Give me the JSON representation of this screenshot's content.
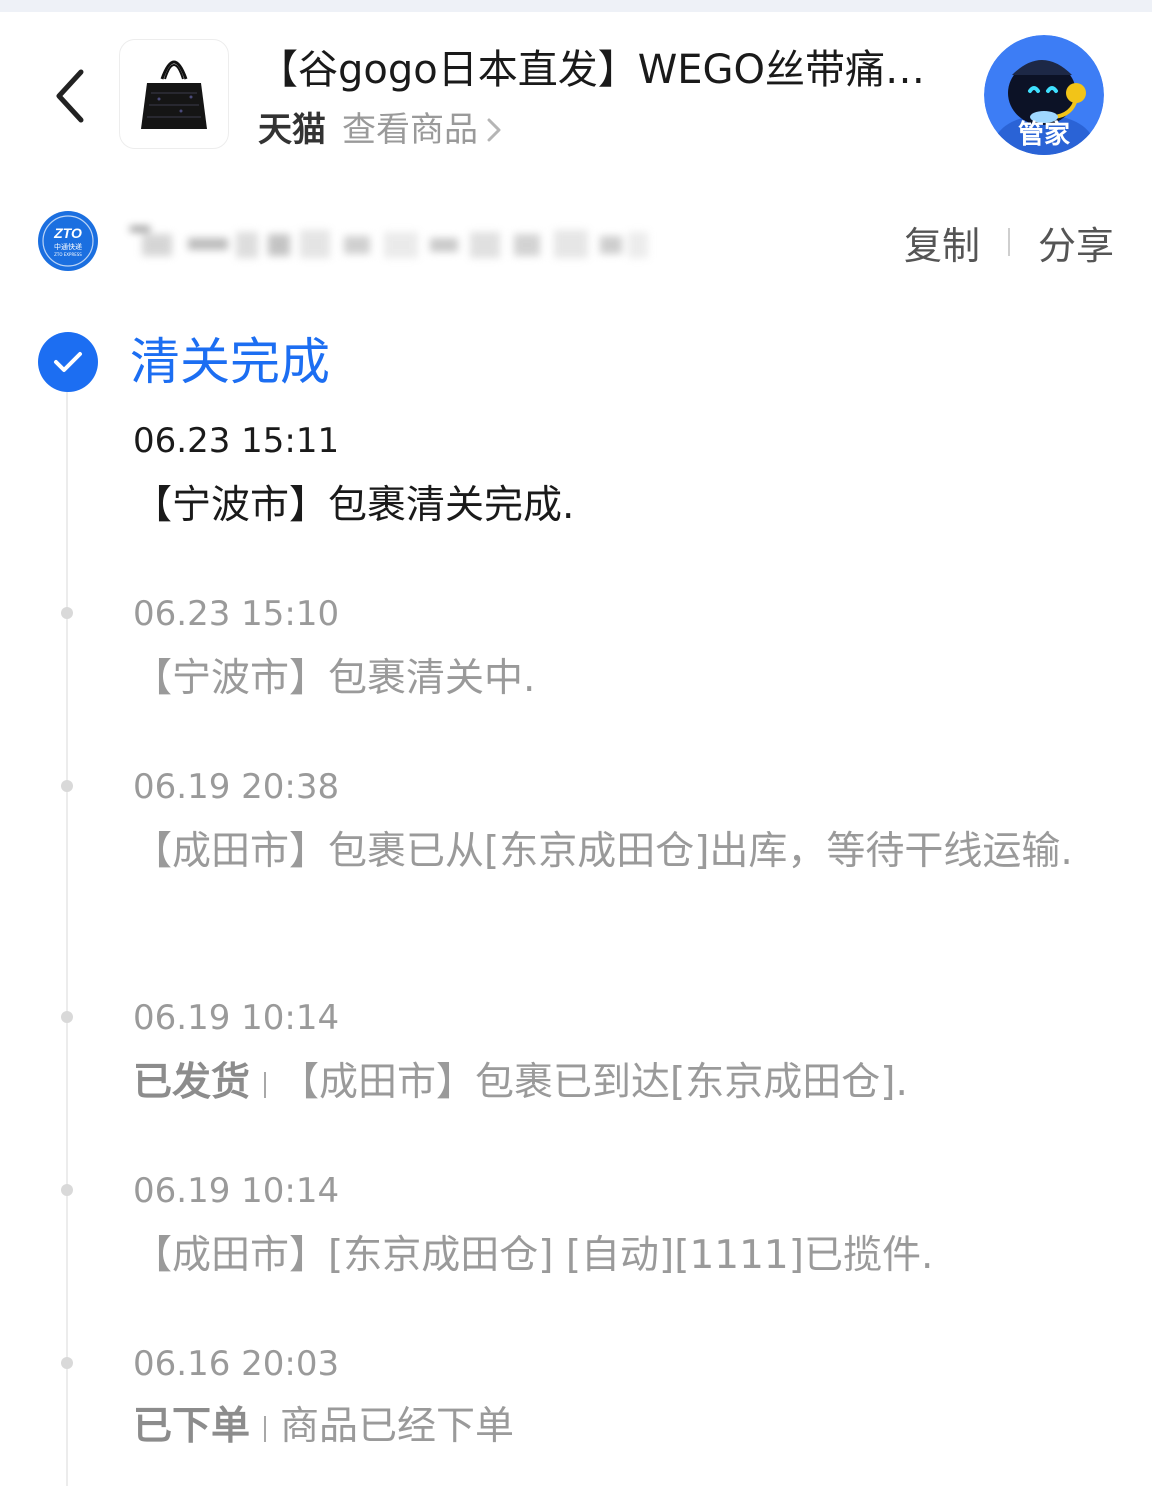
{
  "header": {
    "title": "【谷gogo日本直发】WEGO丝带痛…",
    "shop_name": "天猫",
    "view_product": "查看商品",
    "assistant_label": "管家"
  },
  "courier": {
    "logo_text_main": "ZTO",
    "logo_text_cn": "中通快递",
    "logo_text_en": "ZTO EXPRESS",
    "copy": "复制",
    "share": "分享"
  },
  "status": {
    "title": "清关完成"
  },
  "events": [
    {
      "time": "06.23 15:11",
      "tag": "",
      "desc": "【宁波市】包裹清关完成."
    },
    {
      "time": "06.23 15:10",
      "tag": "",
      "desc": "【宁波市】包裹清关中."
    },
    {
      "time": "06.19 20:38",
      "tag": "",
      "desc": "【成田市】包裹已从[东京成田仓]出库，等待干线运输."
    },
    {
      "time": "06.19 10:14",
      "tag": "已发货",
      "desc": "【成田市】包裹已到达[东京成田仓]."
    },
    {
      "time": "06.19 10:14",
      "tag": "",
      "desc": "【成田市】[东京成田仓] [自动][1111]已揽件."
    },
    {
      "time": "06.16 20:03",
      "tag": "已下单",
      "desc": "商品已经下单"
    }
  ],
  "colors": {
    "accent": "#1c6ef2",
    "muted_text": "#9a9a9a",
    "primary_text": "#1a1a1a"
  }
}
